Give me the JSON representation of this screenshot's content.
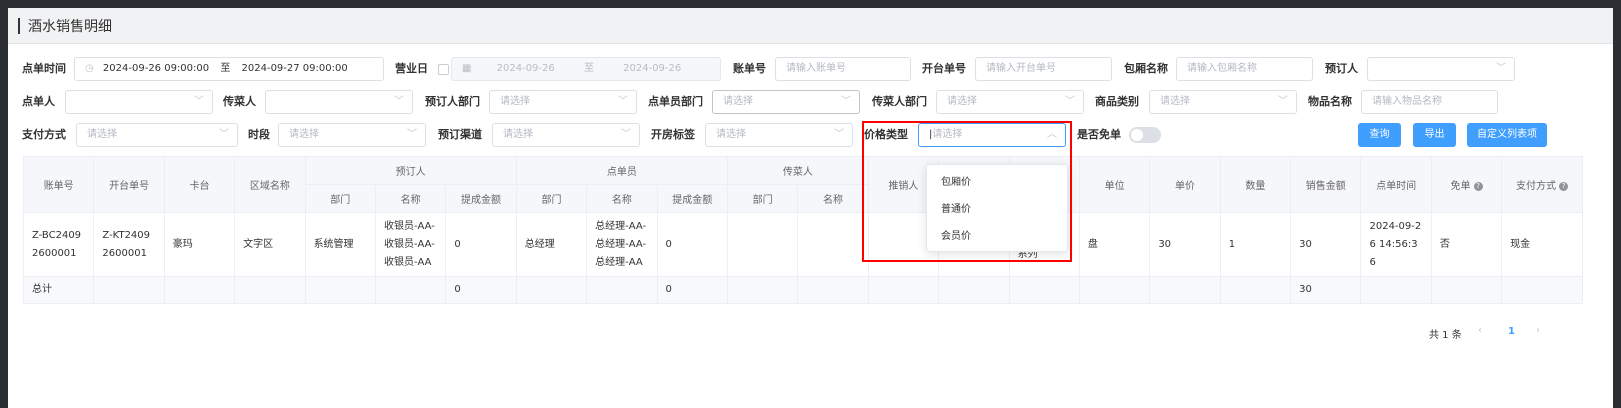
{
  "page": {
    "title": "酒水销售明细"
  },
  "filters": {
    "order_time_label": "点单时间",
    "order_time_start": "2024-09-26 09:00:00",
    "order_time_sep": "至",
    "order_time_end": "2024-09-27 09:00:00",
    "business_day_label": "营业日",
    "business_day_start": "2024-09-26",
    "business_day_sep": "至",
    "business_day_end": "2024-09-26",
    "bill_no_label": "账单号",
    "bill_no_placeholder": "请输入账单号",
    "open_no_label": "开台单号",
    "open_no_placeholder": "请输入开台单号",
    "room_name_label": "包厢名称",
    "room_name_placeholder": "请输入包厢名称",
    "booker_label": "预订人",
    "orderer_label": "点单人",
    "server_label": "传菜人",
    "booker_dept_label": "预订人部门",
    "booker_dept_placeholder": "请选择",
    "orderer_dept_label": "点单员部门",
    "orderer_dept_placeholder": "请选择",
    "server_dept_label": "传菜人部门",
    "server_dept_placeholder": "请选择",
    "category_label": "商品类别",
    "category_placeholder": "请选择",
    "item_name_label": "物品名称",
    "item_name_placeholder": "请输入物品名称",
    "payment_label": "支付方式",
    "payment_placeholder": "请选择",
    "period_label": "时段",
    "period_placeholder": "请选择",
    "channel_label": "预订渠道",
    "channel_placeholder": "请选择",
    "room_tag_label": "开房标签",
    "room_tag_placeholder": "请选择",
    "price_type_label": "价格类型",
    "price_type_placeholder": "请选择",
    "free_label": "是否免单"
  },
  "buttons": {
    "query": "查询",
    "export": "导出",
    "custom_columns": "自定义列表项"
  },
  "price_type_options": [
    "包厢价",
    "普通价",
    "会员价"
  ],
  "table": {
    "headers": {
      "bill_no": "账单号",
      "open_no": "开台单号",
      "table": "卡台",
      "area": "区域名称",
      "booker": "预订人",
      "orderer": "点单员",
      "server": "传菜人",
      "promoter": "推销人",
      "unit": "单位",
      "price": "单价",
      "qty": "数量",
      "amount": "销售金额",
      "order_time": "点单时间",
      "free": "免单",
      "payment": "支付方式",
      "dept": "部门",
      "name": "名称",
      "commission": "提成金额"
    },
    "row": {
      "bill_no": "Z-BC24092600001",
      "open_no": "Z-KT24092600001",
      "table": "豪玛",
      "area": "文字区",
      "booker_dept": "系统管理",
      "booker_name": "收银员-AA-收银员-AA-收银员-AA",
      "booker_commission": "0",
      "orderer_dept": "总经理",
      "orderer_name": "总经理-AA-总经理-AA-总经理-AA",
      "orderer_commission": "0",
      "category_fragment": "系列",
      "unit": "盘",
      "price": "30",
      "qty": "1",
      "amount": "30",
      "order_time": "2024-09-26 14:56:36",
      "free": "否",
      "payment": "现金"
    },
    "summary": {
      "label": "总计",
      "booker_commission": "0",
      "orderer_commission": "0",
      "amount": "30"
    }
  },
  "pagination": {
    "total": "共 1 条",
    "current": "1"
  }
}
